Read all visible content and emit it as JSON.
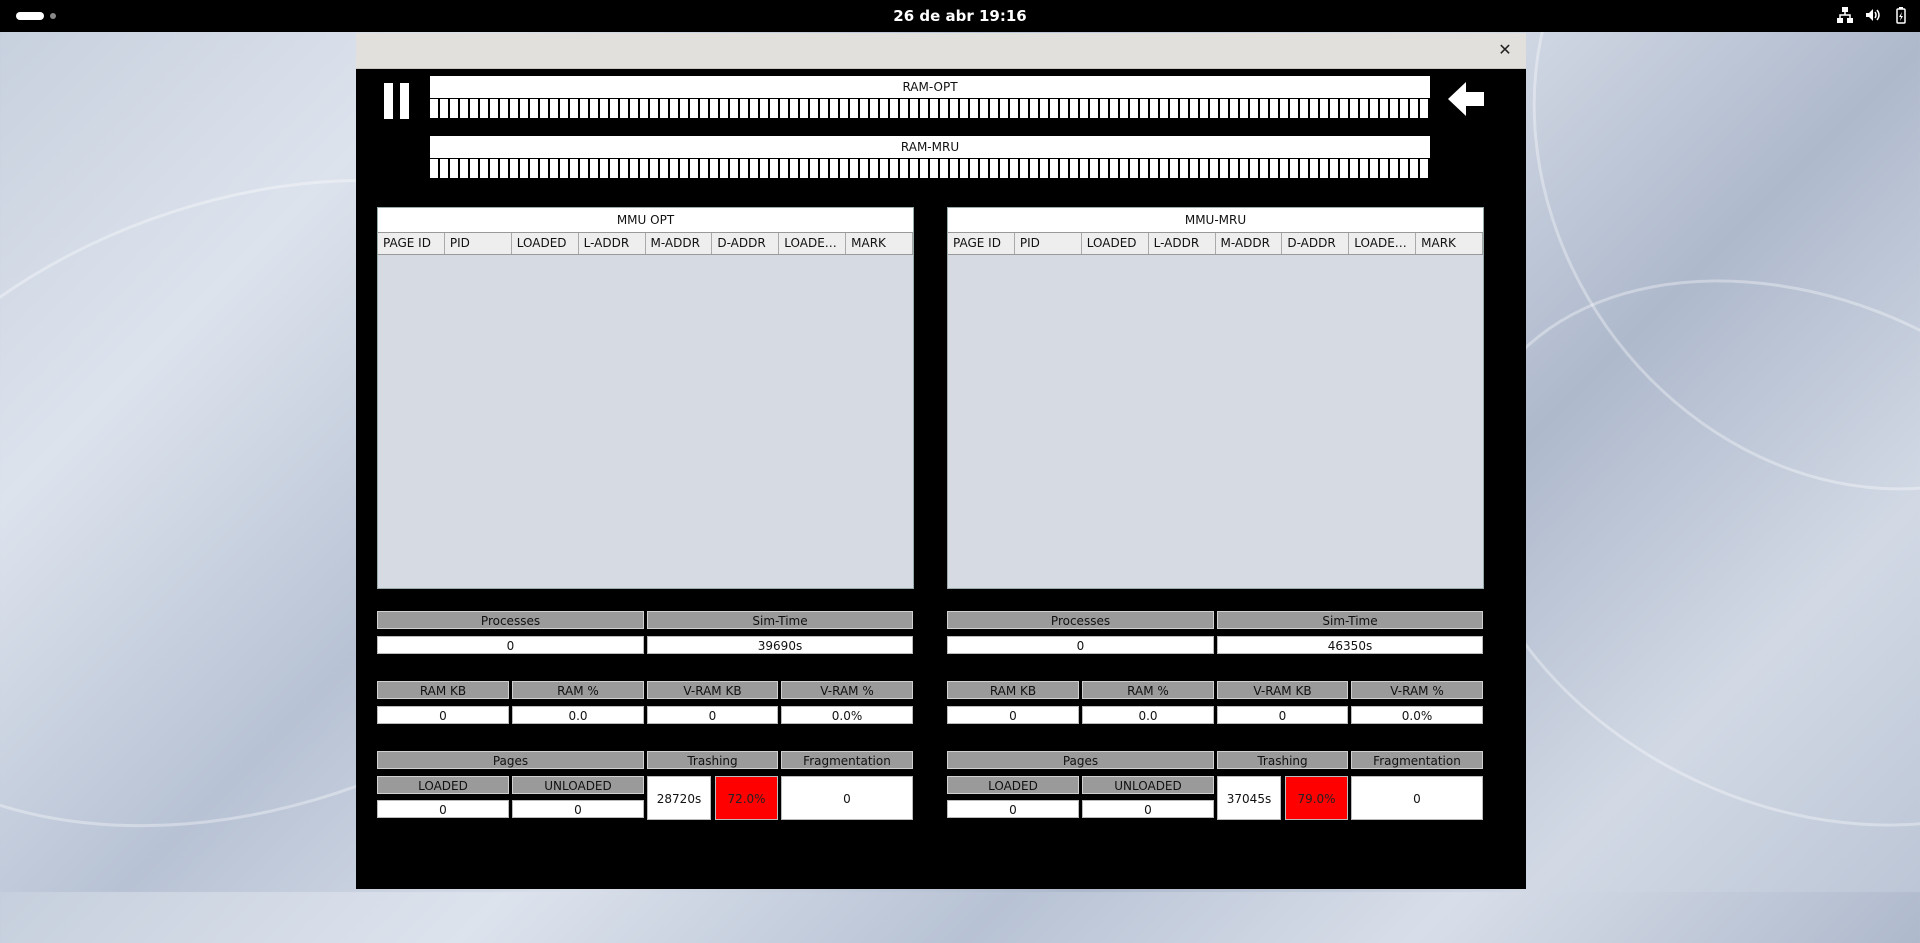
{
  "topbar": {
    "clock": "26 de abr  19:16"
  },
  "ram_opt": {
    "label": "RAM-OPT"
  },
  "ram_mru": {
    "label": "RAM-MRU"
  },
  "columns": [
    "PAGE ID",
    "PID",
    "LOADED",
    "L-ADDR",
    "M-ADDR",
    "D-ADDR",
    "LOADED...",
    "MARK"
  ],
  "left": {
    "mmu_title": "MMU OPT",
    "processes_label": "Processes",
    "processes": "0",
    "simtime_label": "Sim-Time",
    "simtime": "39690s",
    "ram_kb_label": "RAM KB",
    "ram_kb": "0",
    "ram_pct_label": "RAM %",
    "ram_pct": "0.0",
    "vram_kb_label": "V-RAM KB",
    "vram_kb": "0",
    "vram_pct_label": "V-RAM %",
    "vram_pct": "0.0%",
    "pages_label": "Pages",
    "loaded_label": "LOADED",
    "loaded": "0",
    "unloaded_label": "UNLOADED",
    "unloaded": "0",
    "trashing_label": "Trashing",
    "trashing_time": "28720s",
    "trashing_pct": "72.0%",
    "frag_label": "Fragmentation",
    "frag": "0"
  },
  "right": {
    "mmu_title": "MMU-MRU",
    "processes_label": "Processes",
    "processes": "0",
    "simtime_label": "Sim-Time",
    "simtime": "46350s",
    "ram_kb_label": "RAM KB",
    "ram_kb": "0",
    "ram_pct_label": "RAM %",
    "ram_pct": "0.0",
    "vram_kb_label": "V-RAM KB",
    "vram_kb": "0",
    "vram_pct_label": "V-RAM %",
    "vram_pct": "0.0%",
    "pages_label": "Pages",
    "loaded_label": "LOADED",
    "loaded": "0",
    "unloaded_label": "UNLOADED",
    "unloaded": "0",
    "trashing_label": "Trashing",
    "trashing_time": "37045s",
    "trashing_pct": "79.0%",
    "frag_label": "Fragmentation",
    "frag": "0"
  },
  "icons": {
    "pause": "pause-icon",
    "back": "back-arrow-icon",
    "close": "close-icon",
    "network": "network-icon",
    "volume": "volume-icon",
    "battery": "battery-icon"
  },
  "colors": {
    "trashing_alert": "#ff0000",
    "header_gray": "#9a9a9a",
    "mmu_bg": "#d6dae2"
  }
}
